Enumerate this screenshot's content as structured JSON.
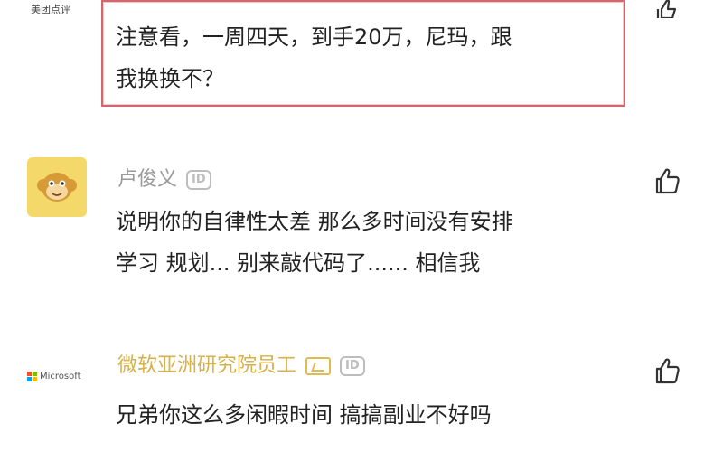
{
  "top_comment": {
    "source_logo_text": "美团点评",
    "text_line1": "注意看，一周四天，到手20万，尼玛，跟",
    "text_line2": "我换换不？"
  },
  "comments": [
    {
      "username": "卢俊义",
      "id_badge": "ID",
      "avatar_icon": "monkey-avatar-icon",
      "line1": "说明你的自律性太差 那么多时间没有安排",
      "line2": "学习 规划... 别来敲代码了...... 相信我",
      "like_icon": "thumbs-up-icon"
    },
    {
      "username": "微软亚洲研究院员工",
      "id_badge": "ID",
      "avatar_text": "Microsoft",
      "avatar_icon": "microsoft-logo-icon",
      "verified_icon": "verified-badge-icon",
      "line1": "兄弟你这么多闲暇时间 搞搞副业不好吗",
      "like_icon": "thumbs-up-icon"
    }
  ],
  "colors": {
    "highlight_border": "#d2686e",
    "username_gray": "#9a9a9a",
    "username_gold": "#d6b24a",
    "avatar_yellow": "#f5d86a"
  }
}
